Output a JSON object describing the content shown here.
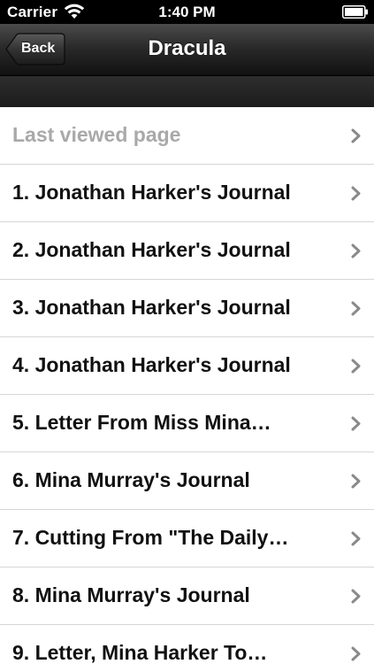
{
  "status_bar": {
    "carrier": "Carrier",
    "time": "1:40 PM",
    "wifi_icon": "wifi-icon",
    "battery_icon": "battery-icon"
  },
  "nav": {
    "back_label": "Back",
    "title": "Dracula"
  },
  "list": {
    "items": [
      {
        "label": "Last viewed page",
        "disabled": true
      },
      {
        "label": "1. Jonathan Harker's Journal",
        "disabled": false
      },
      {
        "label": "2. Jonathan Harker's Journal",
        "disabled": false
      },
      {
        "label": "3. Jonathan Harker's Journal",
        "disabled": false
      },
      {
        "label": "4. Jonathan Harker's Journal",
        "disabled": false
      },
      {
        "label": "5. Letter From Miss Mina…",
        "disabled": false
      },
      {
        "label": "6. Mina Murray's Journal",
        "disabled": false
      },
      {
        "label": "7. Cutting From \"The Daily…",
        "disabled": false
      },
      {
        "label": "8. Mina Murray's Journal",
        "disabled": false
      },
      {
        "label": "9. Letter, Mina Harker To…",
        "disabled": false
      }
    ]
  },
  "colors": {
    "item_text": "#111111",
    "disabled_text": "#a9a9a9",
    "chevron": "#8a8a8a",
    "separator": "#d6d6d6"
  }
}
